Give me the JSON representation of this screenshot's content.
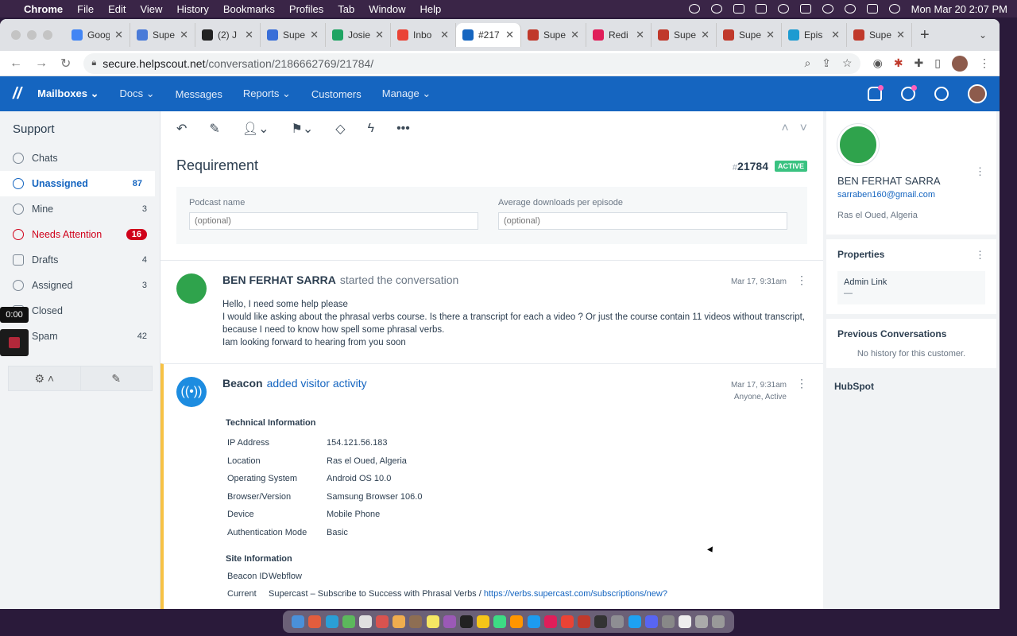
{
  "menubar": {
    "app": "Chrome",
    "items": [
      "File",
      "Edit",
      "View",
      "History",
      "Bookmarks",
      "Profiles",
      "Tab",
      "Window",
      "Help"
    ],
    "clock": "Mon Mar 20  2:07 PM"
  },
  "browser": {
    "tabs": [
      {
        "label": "Goog",
        "color": "#4285f4"
      },
      {
        "label": "Supe",
        "color": "#4a7bd8"
      },
      {
        "label": "(2) J",
        "color": "#222222"
      },
      {
        "label": "Supe",
        "color": "#3a6fd8"
      },
      {
        "label": "Josie",
        "color": "#1fa463"
      },
      {
        "label": "Inbo",
        "color": "#ea4335"
      },
      {
        "label": "#217",
        "color": "#1565c0"
      },
      {
        "label": "Supe",
        "color": "#c0392b"
      },
      {
        "label": "Redi",
        "color": "#e01e5a"
      },
      {
        "label": "Supe",
        "color": "#c0392b"
      },
      {
        "label": "Supe",
        "color": "#c0392b"
      },
      {
        "label": "Epis",
        "color": "#1d9bd1"
      },
      {
        "label": "Supe",
        "color": "#c0392b"
      }
    ],
    "url_host": "secure.helpscout.net",
    "url_path": "/conversation/2186662769/21784/"
  },
  "hsnav": {
    "mailboxes": "Mailboxes ⌄",
    "docs": "Docs ⌄",
    "messages": "Messages",
    "reports": "Reports ⌄",
    "customers": "Customers",
    "manage": "Manage ⌄"
  },
  "sidebar": {
    "title": "Support",
    "items": [
      {
        "label": "Chats",
        "count": ""
      },
      {
        "label": "Unassigned",
        "count": "87"
      },
      {
        "label": "Mine",
        "count": "3"
      },
      {
        "label": "Needs Attention",
        "count": "16"
      },
      {
        "label": "Drafts",
        "count": "4"
      },
      {
        "label": "Assigned",
        "count": "3"
      },
      {
        "label": "Closed",
        "count": ""
      },
      {
        "label": "Spam",
        "count": "42"
      }
    ],
    "timer": "0:00"
  },
  "conversation": {
    "subject": "Requirement",
    "hash": "#",
    "number": "21784",
    "status": "ACTIVE",
    "fields": [
      {
        "label": "Podcast name",
        "placeholder": "(optional)"
      },
      {
        "label": "Average downloads per episode",
        "placeholder": "(optional)"
      }
    ],
    "thread1": {
      "author": "BEN FERHAT SARRA",
      "action": "started the conversation",
      "time": "Mar 17, 9:31am",
      "lines": [
        "Hello, I need some help please",
        "I would like asking about the phrasal verbs course. Is there a transcript for each a video ? Or just the course contain 11 videos without transcript, because I need to know how spell some phrasal verbs.",
        "Iam looking forward to hearing from you soon"
      ]
    },
    "thread2": {
      "author": "Beacon",
      "action": "added visitor activity",
      "time": "Mar 17, 9:31am",
      "sub": "Anyone, Active",
      "tech_title": "Technical Information",
      "tech": [
        {
          "k": "IP Address",
          "v": "154.121.56.183"
        },
        {
          "k": "Location",
          "v": "Ras el Oued, Algeria"
        },
        {
          "k": "Operating System",
          "v": "Android OS 10.0"
        },
        {
          "k": "Browser/Version",
          "v": "Samsung Browser 106.0"
        },
        {
          "k": "Device",
          "v": "Mobile Phone"
        },
        {
          "k": "Authentication Mode",
          "v": "Basic"
        }
      ],
      "site_title": "Site Information",
      "site": [
        {
          "k": "Beacon ID",
          "v": "Webflow"
        },
        {
          "k": "Current",
          "v": "Supercast – Subscribe to Success with Phrasal Verbs / ",
          "link": "https://verbs.supercast.com/subscriptions/new?"
        }
      ]
    }
  },
  "customer": {
    "name": "BEN FERHAT SARRA",
    "email": "sarraben160@gmail.com",
    "location": "Ras el Oued, Algeria"
  },
  "properties": {
    "title": "Properties",
    "label": "Admin Link",
    "value": "—"
  },
  "previous": {
    "title": "Previous Conversations",
    "empty": "No history for this customer."
  },
  "hubspot": {
    "title": "HubSpot"
  },
  "colors": {
    "brand": "#1565c0",
    "active": "#3ac281",
    "alert": "#d0021b",
    "beacon_accent": "#f7c244"
  },
  "dock": [
    "#4a90d9",
    "#e35d3d",
    "#2a9fd6",
    "#5cb85c",
    "#e0e0e0",
    "#d9534f",
    "#f0ad4e",
    "#8e6e53",
    "#f5e663",
    "#9b59b6",
    "#222222",
    "#f5c518",
    "#3ddc84",
    "#ff9500",
    "#1d9bf0",
    "#e01e5a",
    "#ea4335",
    "#c0392b",
    "#333333",
    "#8e8e93",
    "#1da1f2",
    "#5865f2",
    "#888888",
    "#eeeeee",
    "#aaaaaa",
    "#999999"
  ]
}
